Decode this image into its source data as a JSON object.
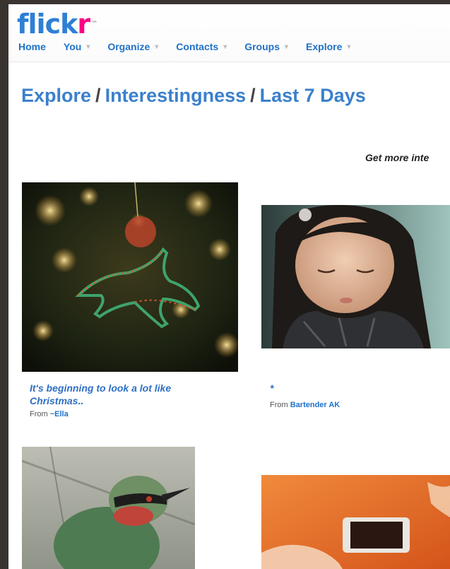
{
  "logo": {
    "part1": "flick",
    "part2": "r",
    "tm": "™"
  },
  "nav": [
    {
      "label": "Home",
      "caret": false
    },
    {
      "label": "You",
      "caret": true
    },
    {
      "label": "Organize",
      "caret": true
    },
    {
      "label": "Contacts",
      "caret": true
    },
    {
      "label": "Groups",
      "caret": true
    },
    {
      "label": "Explore",
      "caret": true
    }
  ],
  "caret_glyph": "▾",
  "title": {
    "part1": "Explore",
    "sep": "/",
    "part2": "Interestingness",
    "part3": "Last 7 Days"
  },
  "get_more": "Get more inte",
  "photos": [
    {
      "title_line1": "It's beginning to look a lot like",
      "title_line2": "Christmas..",
      "from_label": "From",
      "owner": "~Ella"
    },
    {
      "title_line1": "*",
      "title_line2": "",
      "from_label": "From",
      "owner": "Bartender AK"
    }
  ]
}
